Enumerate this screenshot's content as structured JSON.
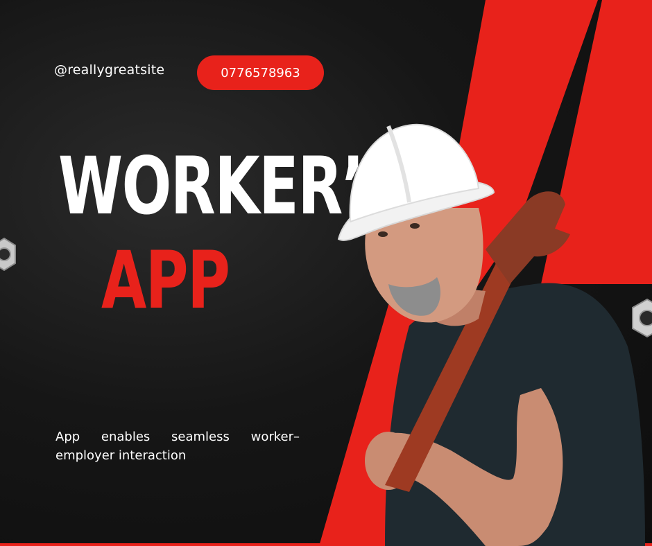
{
  "header": {
    "website": "@reallygreatsite",
    "phone": "0776578963"
  },
  "title": {
    "line1": "WORKER’S",
    "line2": "APP"
  },
  "description": "App enables seamless worker–employer interaction",
  "colors": {
    "accent_red": "#e8221b",
    "background": "#121212",
    "text": "#ffffff"
  },
  "icons": [
    "hex-nut-icon",
    "hex-nut-icon"
  ],
  "photo": "construction worker in white hard hat holding a pipe wrench"
}
